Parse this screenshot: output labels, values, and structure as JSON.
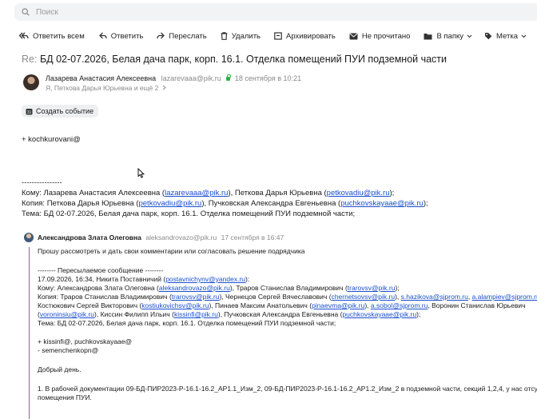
{
  "search": {
    "placeholder": "Поиск"
  },
  "toolbar": [
    {
      "label": "Ответить всем",
      "icon": "reply-all-icon"
    },
    {
      "label": "Ответить",
      "icon": "reply-icon"
    },
    {
      "label": "Переслать",
      "icon": "forward-icon"
    },
    {
      "label": "Удалить",
      "icon": "trash-icon"
    },
    {
      "label": "Архивировать",
      "icon": "archive-icon"
    },
    {
      "label": "Не прочитано",
      "icon": "unread-icon"
    },
    {
      "label": "В папку",
      "icon": "folder-icon"
    },
    {
      "label": "Метка",
      "icon": "tag-icon"
    }
  ],
  "message": {
    "subject_prefix": "Re:",
    "subject": "БД 02-07.2026, Белая дача парк, корп. 16.1. Отделка помещений ПУИ подземной части",
    "sender_name": "Лазарева Анастасия Алексеевна",
    "sender_email": "lazarevaaa@pik.ru",
    "date": "18 сентября в 10:21",
    "recipients": "Я, Петкова Дарья Юрьевна и ещё 2",
    "event_button": "Создать событие",
    "body_line1": "+ kochkurovani@",
    "separator": "----------------",
    "to_label": "Кому: Лазарева Анастасия Алексеевна (",
    "to_email1": "lazarevaaa@pik.ru",
    "to_mid": "), Петкова Дарья Юрьевна (",
    "to_email2": "petkovadiu@pik.ru",
    "to_end": ");",
    "cc_label": "Копия: Петкова Дарья Юрьевна (",
    "cc_email1": "petkovadiu@pik.ru",
    "cc_mid": "), Пучковская Александра Евгеньевна (",
    "cc_email2": "puchkovskayaae@pik.ru",
    "cc_end": ");",
    "subject_line": "Тема: БД 02-07.2026, Белая дача парк, корп. 16.1. Отделка помещений ПУИ подземной части;"
  },
  "quoted": {
    "sender_name": "Александрова Злата Олеговна",
    "sender_email": "aleksandrovazo@pik.ru",
    "date": "17 сентября в 16:47",
    "intro": "Прошу рассмотреть и дать свои комментарии или согласовать решение подрядчика",
    "fwd_header": "-------- Пересылаемое сообщение --------",
    "fwd_date_prefix": "17.09.2026, 16:34, Никита Поставничий (",
    "fwd_date_email": "postavnichynv@yandex.ru",
    "fwd_date_end": "):",
    "to_prefix": "Кому: Александрова Злата Олеговна (",
    "to_email1": "aleksandrovazo@pik.ru",
    "to_mid": "), Траров Станислав Владимирович (",
    "to_email2": "trarovsv@pik.ru",
    "to_end": ");",
    "cc_prefix": "Копия: Траров Станислав Владимирович (",
    "cc_email1": "trarovsv@pik.ru",
    "cc_mid1": "), Чернецов Сергей Вячеславович (",
    "cc_email2": "chernetsovsv@pik.ru",
    "cc_mid2": "), ",
    "cc_email3": "s.hazikova@sjprom.ru",
    "cc_mid3": ", ",
    "cc_email4": "a.alampiev@sjprom.ru",
    "cc_end": ",",
    "line3_prefix": "Костюкович Сергей Викторович (",
    "line3_email1": "kostiukovichsv@pik.ru",
    "line3_mid1": "), Пинаев Максим Анатольевич (",
    "line3_email2": "pinaevma@pik.ru",
    "line3_mid2": "), ",
    "line3_email3": "a.sobol@sjprom.ru",
    "line3_end": ", Воронин Станислав Юрьевич",
    "line4_prefix": "(",
    "line4_email1": "voroninsiu@pik.ru",
    "line4_mid1": "), Киссин Филипп Ильич (",
    "line4_email2": "kissinfi@pik.ru",
    "line4_mid2": "), Пучковская Александра Евгеньевна (",
    "line4_email3": "puchkovskayaae@pik.ru",
    "line4_end": ");",
    "subject_line": "Тема: БД 02-07.2026, Белая дача парк, корп. 16.1. Отделка помещений ПУИ подземной части;",
    "plus_line": "+ kissinfi@, puchkovskayaae@",
    "minus_line": "- semenchenkopn@",
    "greeting": "Добрый день.",
    "item1_line1": "1. В рабочей документации 09-БД-ПИР2023-Р-16.1-16.2_АР1.1_Изм_2, 09-БД-ПИР2023-Р-16.1-16.2_АР1.2_Изм_2 в подземной части, секций 1,2,4, у нас отсу",
    "item1_line2": "помещения ПУИ."
  }
}
